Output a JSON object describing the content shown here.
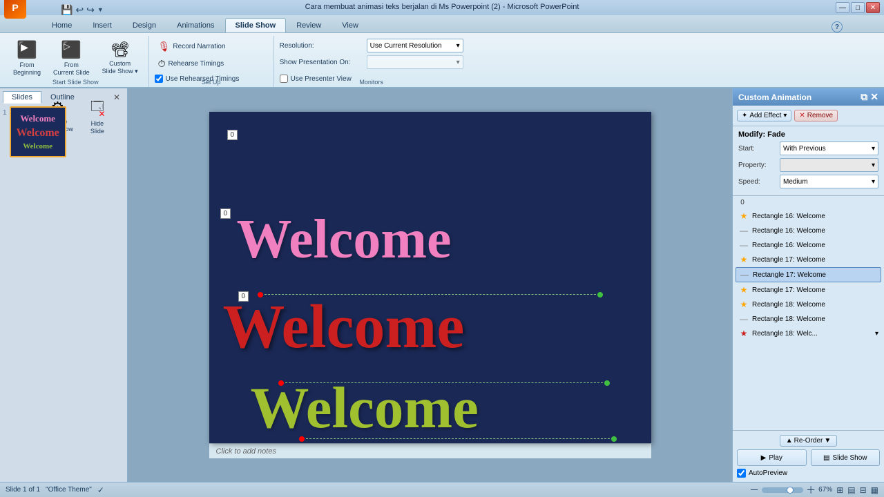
{
  "window": {
    "title": "Cara membuat animasi teks berjalan di Ms Powerpoint (2) - Microsoft PowerPoint",
    "min_label": "—",
    "max_label": "□",
    "close_label": "✕"
  },
  "tabs": {
    "items": [
      "Home",
      "Insert",
      "Design",
      "Animations",
      "Slide Show",
      "Review",
      "View"
    ],
    "active": "Slide Show"
  },
  "ribbon": {
    "groups": [
      {
        "label": "Start Slide Show",
        "buttons": [
          {
            "id": "from-beginning",
            "icon": "▶",
            "label": "From\nBeginning"
          },
          {
            "id": "from-current",
            "icon": "▷",
            "label": "From\nCurrent Slide"
          },
          {
            "id": "custom-slideshow",
            "icon": "⬛",
            "label": "Custom\nSlide Show"
          },
          {
            "id": "setup-slideshow",
            "icon": "⚙",
            "label": "Set Up\nSlide Show"
          },
          {
            "id": "hide-slide",
            "icon": "🔳",
            "label": "Hide\nSlide"
          }
        ]
      },
      {
        "label": "Set Up",
        "items": [
          {
            "icon": "🎙",
            "label": "Record Narration"
          },
          {
            "icon": "⏱",
            "label": "Rehearse Timings"
          },
          {
            "label": "Use Rehearsed Timings",
            "checkbox": true
          }
        ]
      },
      {
        "label": "Monitors",
        "resolution_label": "Resolution:",
        "resolution_value": "Use Current Resolution",
        "show_on_label": "Show Presentation On:",
        "show_on_value": "",
        "presenter_label": "Use Presenter View",
        "presenter_checked": false
      }
    ]
  },
  "slide_panel": {
    "tabs": [
      "Slides",
      "Outline"
    ],
    "active_tab": "Slides",
    "slide": {
      "number": "1",
      "pink_text": "Welcome",
      "red_text": "Welcome",
      "green_text": "Welcome"
    }
  },
  "canvas": {
    "badge1_value": "0",
    "badge2_value": "0",
    "badge3_value": "0",
    "welcome_pink": "Welcome",
    "welcome_red": "Welcome",
    "welcome_green": "Welcome"
  },
  "notes": {
    "placeholder": "Click to add notes"
  },
  "custom_animation": {
    "title": "Custom Animation",
    "add_label": "Add Effect",
    "remove_label": "Remove",
    "modify_title": "Modify: Fade",
    "start_label": "Start:",
    "start_value": "With Previous",
    "property_label": "Property:",
    "property_value": "",
    "speed_label": "Speed:",
    "speed_value": "Medium",
    "list_num": "0",
    "items": [
      {
        "icon": "star",
        "color": "orange",
        "text": "Rectangle 16: Welcome",
        "selected": false,
        "has_arrow": false
      },
      {
        "icon": "line",
        "color": "gray",
        "text": "Rectangle 16: Welcome",
        "selected": false,
        "has_arrow": false
      },
      {
        "icon": "line",
        "color": "gray",
        "text": "Rectangle 16: Welcome",
        "selected": false,
        "has_arrow": false
      },
      {
        "icon": "star",
        "color": "orange",
        "text": "Rectangle 17: Welcome",
        "selected": false,
        "has_arrow": false
      },
      {
        "icon": "line",
        "color": "gray",
        "text": "Rectangle 17: Welcome",
        "selected": true,
        "has_arrow": false
      },
      {
        "icon": "star",
        "color": "orange",
        "text": "Rectangle 17: Welcome",
        "selected": false,
        "has_arrow": false
      },
      {
        "icon": "star",
        "color": "orange",
        "text": "Rectangle 18: Welcome",
        "selected": false,
        "has_arrow": false
      },
      {
        "icon": "line",
        "color": "gray",
        "text": "Rectangle 18: Welcome",
        "selected": false,
        "has_arrow": false
      },
      {
        "icon": "star",
        "color": "red",
        "text": "Rectangle 18: Welc...",
        "selected": false,
        "has_arrow": true
      }
    ],
    "reorder_up_label": "Re-Order",
    "reorder_down_label": "",
    "play_label": "Play",
    "slideshow_label": "Slide Show",
    "autopreview_label": "AutoPreview",
    "autopreview_checked": true
  },
  "status_bar": {
    "slide_info": "Slide 1 of 1",
    "theme": "\"Office Theme\"",
    "zoom_level": "67%"
  }
}
